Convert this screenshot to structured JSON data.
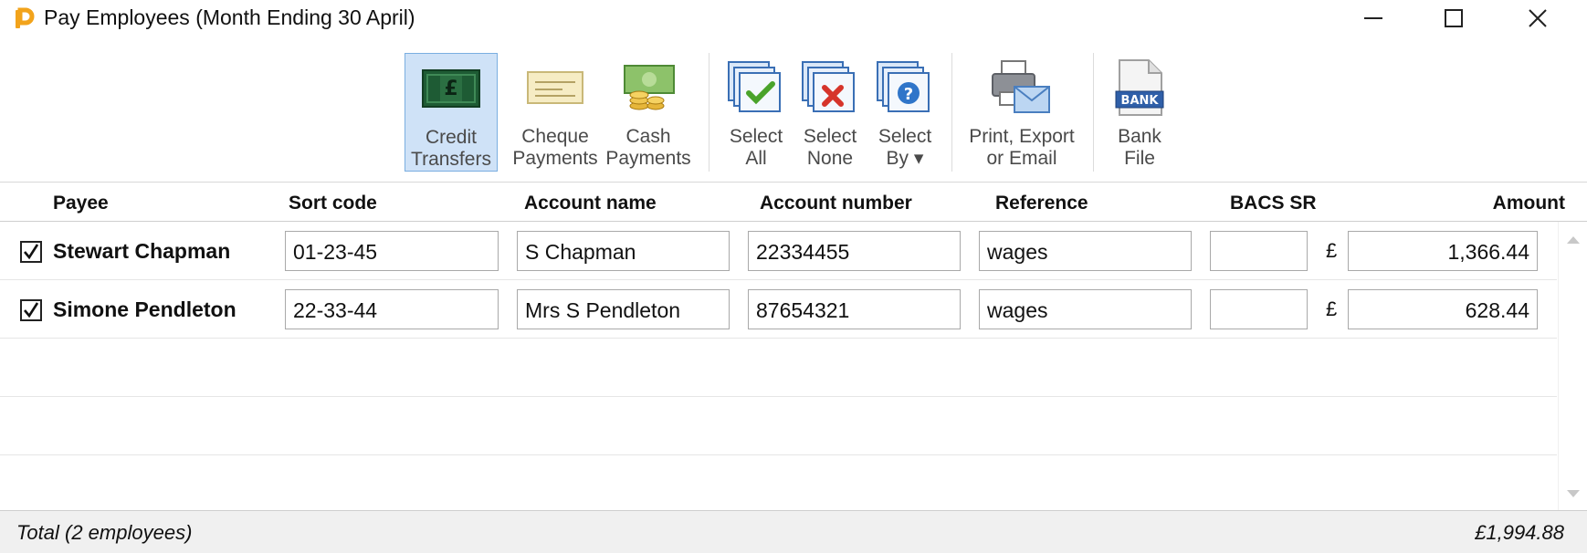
{
  "window": {
    "title": "Pay Employees (Month Ending 30 April)"
  },
  "toolbar": {
    "buttons": [
      {
        "label": "Credit\nTransfers",
        "icon": "banknote-icon",
        "active": true
      },
      {
        "label": "Cheque\nPayments",
        "icon": "cheque-icon",
        "active": false
      },
      {
        "label": "Cash\nPayments",
        "icon": "cash-icon",
        "active": false
      },
      {
        "label": "Select\nAll",
        "icon": "select-all-icon",
        "active": false
      },
      {
        "label": "Select\nNone",
        "icon": "select-none-icon",
        "active": false
      },
      {
        "label": "Select\nBy ▾",
        "icon": "select-by-icon",
        "active": false
      },
      {
        "label": "Print, Export\nor Email",
        "icon": "print-export-icon",
        "active": false
      },
      {
        "label": "Bank\nFile",
        "icon": "bank-file-icon",
        "active": false
      }
    ]
  },
  "table": {
    "columns": [
      "Payee",
      "Sort code",
      "Account name",
      "Account number",
      "Reference",
      "BACS SR",
      "Amount"
    ],
    "currency_symbol": "£",
    "rows": [
      {
        "checked": true,
        "payee": "Stewart Chapman",
        "sort_code": "01-23-45",
        "account_name": "S Chapman",
        "account_number": "22334455",
        "reference": "wages",
        "bacs_sr": "",
        "amount": "1,366.44"
      },
      {
        "checked": true,
        "payee": "Simone Pendleton",
        "sort_code": "22-33-44",
        "account_name": "Mrs S Pendleton",
        "account_number": "87654321",
        "reference": "wages",
        "bacs_sr": "",
        "amount": "628.44"
      }
    ]
  },
  "footer": {
    "total_label": "Total (2 employees)",
    "total_value": "£1,994.88"
  },
  "colors": {
    "active_button_bg": "#cfe2f7",
    "active_button_border": "#7aaee0",
    "logo_orange": "#f2a31b"
  }
}
